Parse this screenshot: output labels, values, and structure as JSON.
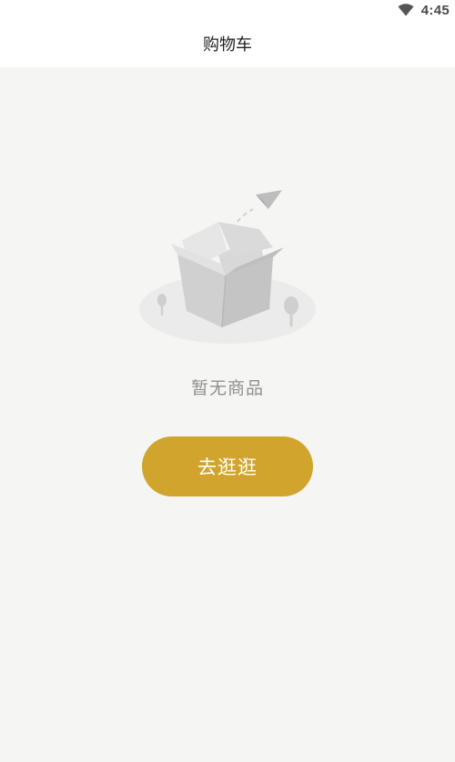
{
  "status_bar": {
    "time": "4:45",
    "wifi_icon": "wifi-icon"
  },
  "header": {
    "title": "购物车"
  },
  "empty_state": {
    "illustration": "empty-box-with-paper-plane",
    "message": "暂无商品",
    "button_label": "去逛逛"
  },
  "colors": {
    "background": "#f5f6f4",
    "header_background": "#ffffff",
    "button": "#d1a52d",
    "message_text": "#8f8f8f"
  }
}
